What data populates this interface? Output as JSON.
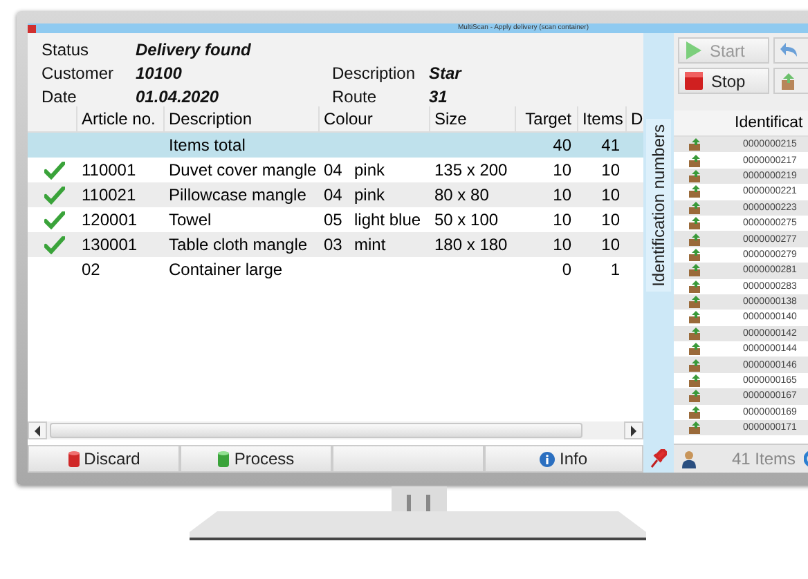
{
  "window": {
    "title": "MultiScan - Apply delivery (scan container)"
  },
  "info_rows": [
    [
      {
        "label": "Status",
        "value": "Delivery found"
      }
    ],
    [
      {
        "label": "Customer",
        "value": "10100"
      },
      {
        "label": "Description",
        "value": "Star"
      }
    ],
    [
      {
        "label": "Date",
        "value": "01.04.2020"
      },
      {
        "label": "Route",
        "value": "31"
      }
    ]
  ],
  "table": {
    "columns": [
      "Article no.",
      "Description",
      "Colour",
      "Size",
      "Target",
      "Items",
      "D"
    ],
    "rows": [
      {
        "selected": true,
        "checked": false,
        "article": "",
        "description": "Items total",
        "colour_code": "",
        "colour": "",
        "size": "",
        "target": "40",
        "items": "41"
      },
      {
        "selected": false,
        "checked": true,
        "article": "110001",
        "description": "Duvet cover mangle",
        "colour_code": "04",
        "colour": "pink",
        "size": "135 x 200",
        "target": "10",
        "items": "10"
      },
      {
        "selected": false,
        "checked": true,
        "article": "110021",
        "description": "Pillowcase mangle",
        "colour_code": "04",
        "colour": "pink",
        "size": "80 x 80",
        "target": "10",
        "items": "10"
      },
      {
        "selected": false,
        "checked": true,
        "article": "120001",
        "description": "Towel",
        "colour_code": "05",
        "colour": "light blue",
        "size": "50 x 100",
        "target": "10",
        "items": "10"
      },
      {
        "selected": false,
        "checked": true,
        "article": "130001",
        "description": "Table cloth mangle",
        "colour_code": "03",
        "colour": "mint",
        "size": "180 x 180",
        "target": "10",
        "items": "10"
      },
      {
        "selected": false,
        "checked": false,
        "article": "02",
        "description": "Container large",
        "colour_code": "",
        "colour": "",
        "size": "",
        "target": "0",
        "items": "1"
      }
    ]
  },
  "side_tab": {
    "label": "Identification numbers"
  },
  "actions": [
    {
      "kind": "start",
      "label": "Start",
      "disabled": true
    },
    {
      "kind": "stop",
      "label": "Stop",
      "disabled": false
    }
  ],
  "id_list": {
    "column": "Identificat",
    "rows": [
      "0000000215",
      "0000000217",
      "0000000219",
      "0000000221",
      "0000000223",
      "0000000275",
      "0000000277",
      "0000000279",
      "0000000281",
      "0000000283",
      "0000000138",
      "0000000140",
      "0000000142",
      "0000000144",
      "0000000146",
      "0000000165",
      "0000000167",
      "0000000169",
      "0000000171"
    ]
  },
  "bottom_bar": {
    "buttons": [
      {
        "kind": "discard",
        "label": "Discard"
      },
      {
        "kind": "process",
        "label": "Process"
      },
      {
        "kind": "spacer"
      },
      {
        "kind": "info",
        "label": "Info"
      }
    ],
    "count": "41 Items"
  }
}
